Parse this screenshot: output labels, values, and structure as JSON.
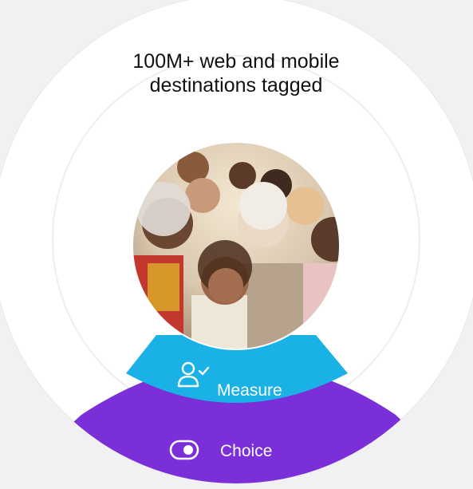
{
  "headline": "100M+ web and mobile destinations tagged",
  "photo": {
    "description_icon": "group-of-people-photo"
  },
  "segments": [
    {
      "label": "Measure",
      "icon": "user-check-icon",
      "color": "#1ab1e6"
    },
    {
      "label": "Choice",
      "icon": "toggle-icon",
      "color": "#7b2fd8"
    }
  ],
  "colors": {
    "background": "#f1f1f3",
    "outer_ring": "#ffffff",
    "inner_disc": "#ffffff",
    "measure": "#1ab1e6",
    "choice": "#7b2fd8"
  }
}
